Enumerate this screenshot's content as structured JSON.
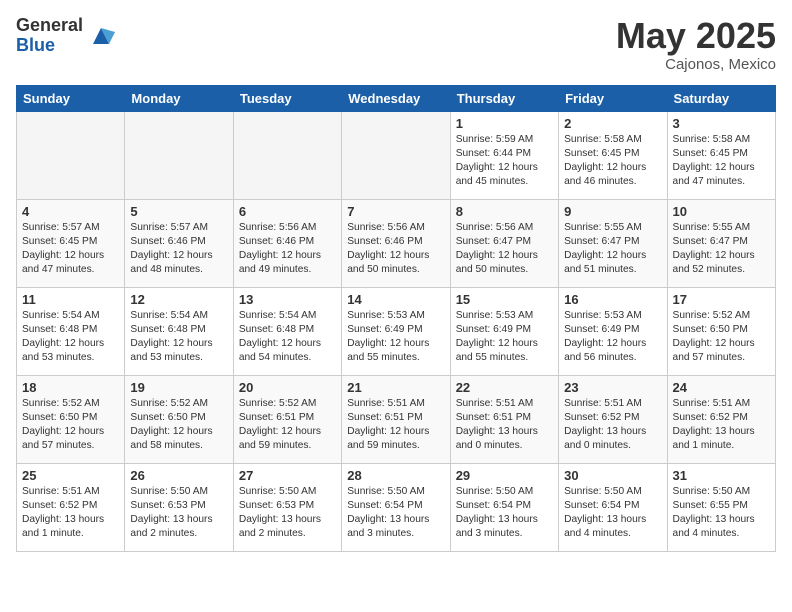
{
  "logo": {
    "general": "General",
    "blue": "Blue"
  },
  "title": "May 2025",
  "location": "Cajonos, Mexico",
  "days_of_week": [
    "Sunday",
    "Monday",
    "Tuesday",
    "Wednesday",
    "Thursday",
    "Friday",
    "Saturday"
  ],
  "weeks": [
    [
      {
        "day": "",
        "info": ""
      },
      {
        "day": "",
        "info": ""
      },
      {
        "day": "",
        "info": ""
      },
      {
        "day": "",
        "info": ""
      },
      {
        "day": "1",
        "info": "Sunrise: 5:59 AM\nSunset: 6:44 PM\nDaylight: 12 hours\nand 45 minutes."
      },
      {
        "day": "2",
        "info": "Sunrise: 5:58 AM\nSunset: 6:45 PM\nDaylight: 12 hours\nand 46 minutes."
      },
      {
        "day": "3",
        "info": "Sunrise: 5:58 AM\nSunset: 6:45 PM\nDaylight: 12 hours\nand 47 minutes."
      }
    ],
    [
      {
        "day": "4",
        "info": "Sunrise: 5:57 AM\nSunset: 6:45 PM\nDaylight: 12 hours\nand 47 minutes."
      },
      {
        "day": "5",
        "info": "Sunrise: 5:57 AM\nSunset: 6:46 PM\nDaylight: 12 hours\nand 48 minutes."
      },
      {
        "day": "6",
        "info": "Sunrise: 5:56 AM\nSunset: 6:46 PM\nDaylight: 12 hours\nand 49 minutes."
      },
      {
        "day": "7",
        "info": "Sunrise: 5:56 AM\nSunset: 6:46 PM\nDaylight: 12 hours\nand 50 minutes."
      },
      {
        "day": "8",
        "info": "Sunrise: 5:56 AM\nSunset: 6:47 PM\nDaylight: 12 hours\nand 50 minutes."
      },
      {
        "day": "9",
        "info": "Sunrise: 5:55 AM\nSunset: 6:47 PM\nDaylight: 12 hours\nand 51 minutes."
      },
      {
        "day": "10",
        "info": "Sunrise: 5:55 AM\nSunset: 6:47 PM\nDaylight: 12 hours\nand 52 minutes."
      }
    ],
    [
      {
        "day": "11",
        "info": "Sunrise: 5:54 AM\nSunset: 6:48 PM\nDaylight: 12 hours\nand 53 minutes."
      },
      {
        "day": "12",
        "info": "Sunrise: 5:54 AM\nSunset: 6:48 PM\nDaylight: 12 hours\nand 53 minutes."
      },
      {
        "day": "13",
        "info": "Sunrise: 5:54 AM\nSunset: 6:48 PM\nDaylight: 12 hours\nand 54 minutes."
      },
      {
        "day": "14",
        "info": "Sunrise: 5:53 AM\nSunset: 6:49 PM\nDaylight: 12 hours\nand 55 minutes."
      },
      {
        "day": "15",
        "info": "Sunrise: 5:53 AM\nSunset: 6:49 PM\nDaylight: 12 hours\nand 55 minutes."
      },
      {
        "day": "16",
        "info": "Sunrise: 5:53 AM\nSunset: 6:49 PM\nDaylight: 12 hours\nand 56 minutes."
      },
      {
        "day": "17",
        "info": "Sunrise: 5:52 AM\nSunset: 6:50 PM\nDaylight: 12 hours\nand 57 minutes."
      }
    ],
    [
      {
        "day": "18",
        "info": "Sunrise: 5:52 AM\nSunset: 6:50 PM\nDaylight: 12 hours\nand 57 minutes."
      },
      {
        "day": "19",
        "info": "Sunrise: 5:52 AM\nSunset: 6:50 PM\nDaylight: 12 hours\nand 58 minutes."
      },
      {
        "day": "20",
        "info": "Sunrise: 5:52 AM\nSunset: 6:51 PM\nDaylight: 12 hours\nand 59 minutes."
      },
      {
        "day": "21",
        "info": "Sunrise: 5:51 AM\nSunset: 6:51 PM\nDaylight: 12 hours\nand 59 minutes."
      },
      {
        "day": "22",
        "info": "Sunrise: 5:51 AM\nSunset: 6:51 PM\nDaylight: 13 hours\nand 0 minutes."
      },
      {
        "day": "23",
        "info": "Sunrise: 5:51 AM\nSunset: 6:52 PM\nDaylight: 13 hours\nand 0 minutes."
      },
      {
        "day": "24",
        "info": "Sunrise: 5:51 AM\nSunset: 6:52 PM\nDaylight: 13 hours\nand 1 minute."
      }
    ],
    [
      {
        "day": "25",
        "info": "Sunrise: 5:51 AM\nSunset: 6:52 PM\nDaylight: 13 hours\nand 1 minute."
      },
      {
        "day": "26",
        "info": "Sunrise: 5:50 AM\nSunset: 6:53 PM\nDaylight: 13 hours\nand 2 minutes."
      },
      {
        "day": "27",
        "info": "Sunrise: 5:50 AM\nSunset: 6:53 PM\nDaylight: 13 hours\nand 2 minutes."
      },
      {
        "day": "28",
        "info": "Sunrise: 5:50 AM\nSunset: 6:54 PM\nDaylight: 13 hours\nand 3 minutes."
      },
      {
        "day": "29",
        "info": "Sunrise: 5:50 AM\nSunset: 6:54 PM\nDaylight: 13 hours\nand 3 minutes."
      },
      {
        "day": "30",
        "info": "Sunrise: 5:50 AM\nSunset: 6:54 PM\nDaylight: 13 hours\nand 4 minutes."
      },
      {
        "day": "31",
        "info": "Sunrise: 5:50 AM\nSunset: 6:55 PM\nDaylight: 13 hours\nand 4 minutes."
      }
    ]
  ]
}
